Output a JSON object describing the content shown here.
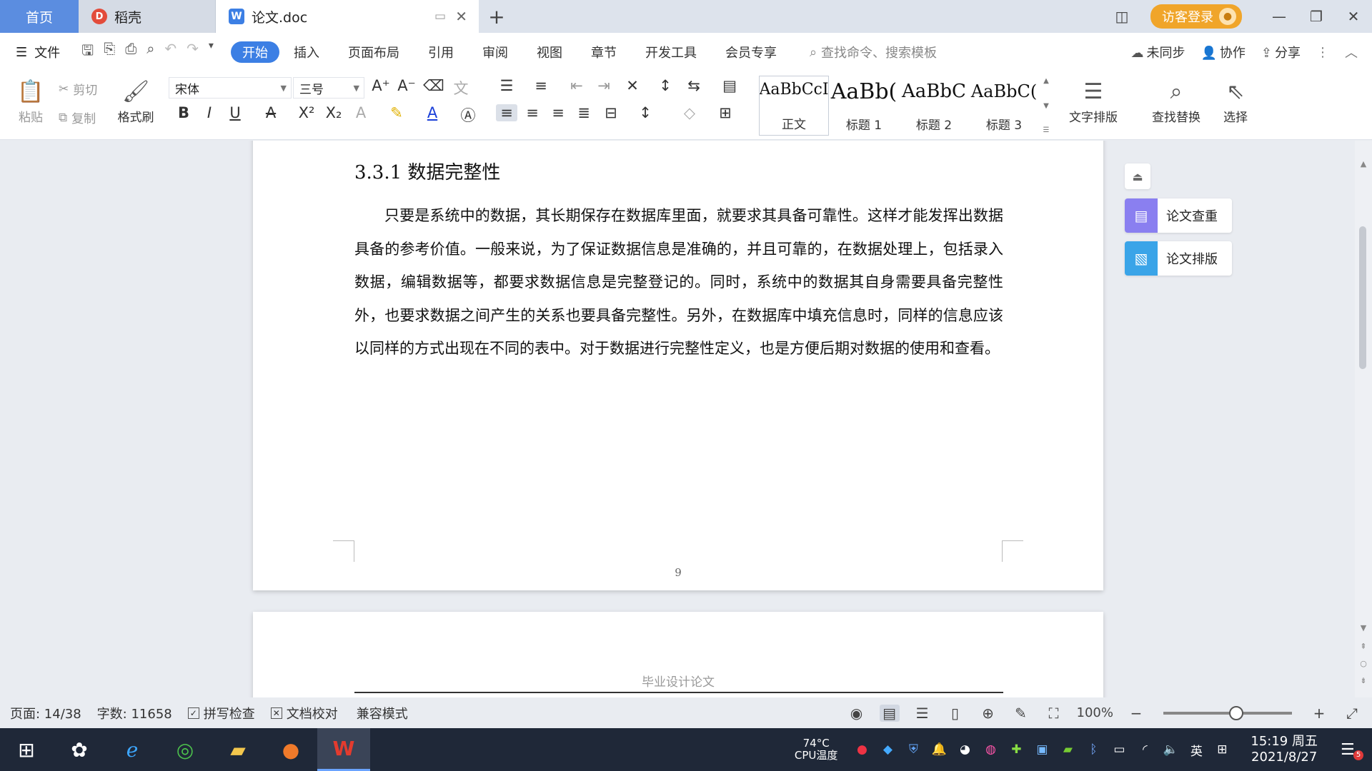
{
  "tabs": {
    "home": "首页",
    "daoke": "稻壳",
    "doc": "论文.doc"
  },
  "titlebar": {
    "login_label": "访客登录"
  },
  "menubar": {
    "file_label": "文件",
    "tabs": [
      "开始",
      "插入",
      "页面布局",
      "引用",
      "审阅",
      "视图",
      "章节",
      "开发工具",
      "会员专享"
    ],
    "search_placeholder": "查找命令、搜索模板",
    "sync_label": "未同步",
    "collab_label": "协作",
    "share_label": "分享"
  },
  "ribbon": {
    "paste_label": "粘贴",
    "cut_label": "剪切",
    "copy_label": "复制",
    "format_painter_label": "格式刷",
    "font_name": "宋体",
    "font_size": "三号",
    "styles": [
      {
        "preview": "AaBbCcI",
        "label": "正文"
      },
      {
        "preview": "AaBb(",
        "label": "标题 1"
      },
      {
        "preview": "AaBbC",
        "label": "标题 2"
      },
      {
        "preview": "AaBbC(",
        "label": "标题 3"
      }
    ],
    "text_layout_label": "文字排版",
    "find_replace_label": "查找替换",
    "select_label": "选择"
  },
  "document": {
    "heading": "3.3.1 数据完整性",
    "paragraph": "只要是系统中的数据，其长期保存在数据库里面，就要求其具备可靠性。这样才能发挥出数据具备的参考价值。一般来说，为了保证数据信息是准确的，并且可靠的，在数据处理上，包括录入数据，编辑数据等，都要求数据信息是完整登记的。同时，系统中的数据其自身需要具备完整性外，也要求数据之间产生的关系也要具备完整性。另外，在数据库中填充信息时，同样的信息应该以同样的方式出现在不同的表中。对于数据进行完整性定义，也是方便后期对数据的使用和查看。",
    "page_number": "9",
    "next_page_header": "毕业设计论文"
  },
  "side_panel": {
    "check_label": "论文查重",
    "layout_label": "论文排版"
  },
  "statusbar": {
    "page": "页面: 14/38",
    "words": "字数: 11658",
    "spell_check": "拼写检查",
    "doc_proof": "文档校对",
    "compat_mode": "兼容模式",
    "zoom": "100%"
  },
  "taskbar": {
    "cpu_temp": "74°C",
    "cpu_label": "CPU温度",
    "ime": "英",
    "time": "15:19 周五",
    "date": "2021/8/27",
    "notif_count": "5"
  },
  "colors": {
    "accent": "#3c7fe4",
    "login": "#f0a52a",
    "taskbar": "#1f2838"
  }
}
